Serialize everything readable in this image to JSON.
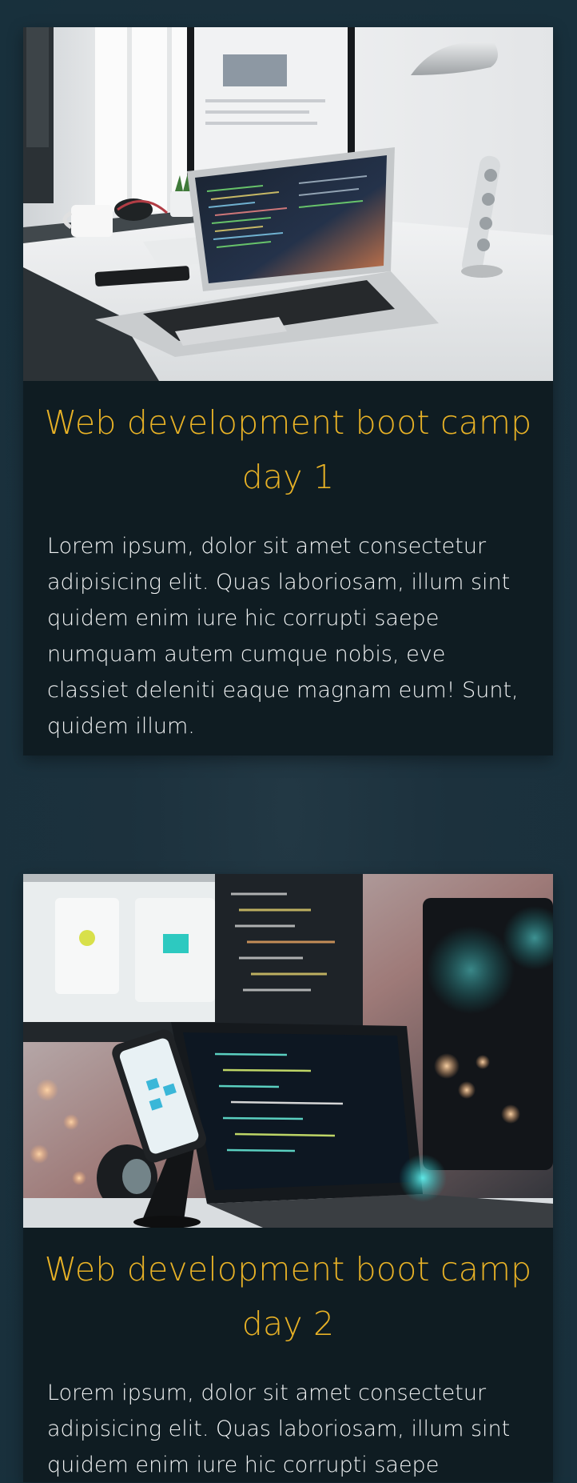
{
  "cards": [
    {
      "title": "Web development boot camp day 1",
      "text": "Lorem ipsum, dolor sit amet consectetur adipisicing elit. Quas laboriosam, illum sint quidem enim iure hic corrupti saepe numquam autem cumque nobis, eve classiet deleniti eaque magnam eum! Sunt, quidem illum."
    },
    {
      "title": "Web development boot camp day 2",
      "text": "Lorem ipsum, dolor sit amet consectetur adipisicing elit. Quas laboriosam, illum sint quidem enim iure hic corrupti saepe"
    }
  ],
  "colors": {
    "background": "#1c313d",
    "card": "#0f1c22",
    "title": "#e7b126",
    "text": "#f2f4f5"
  }
}
